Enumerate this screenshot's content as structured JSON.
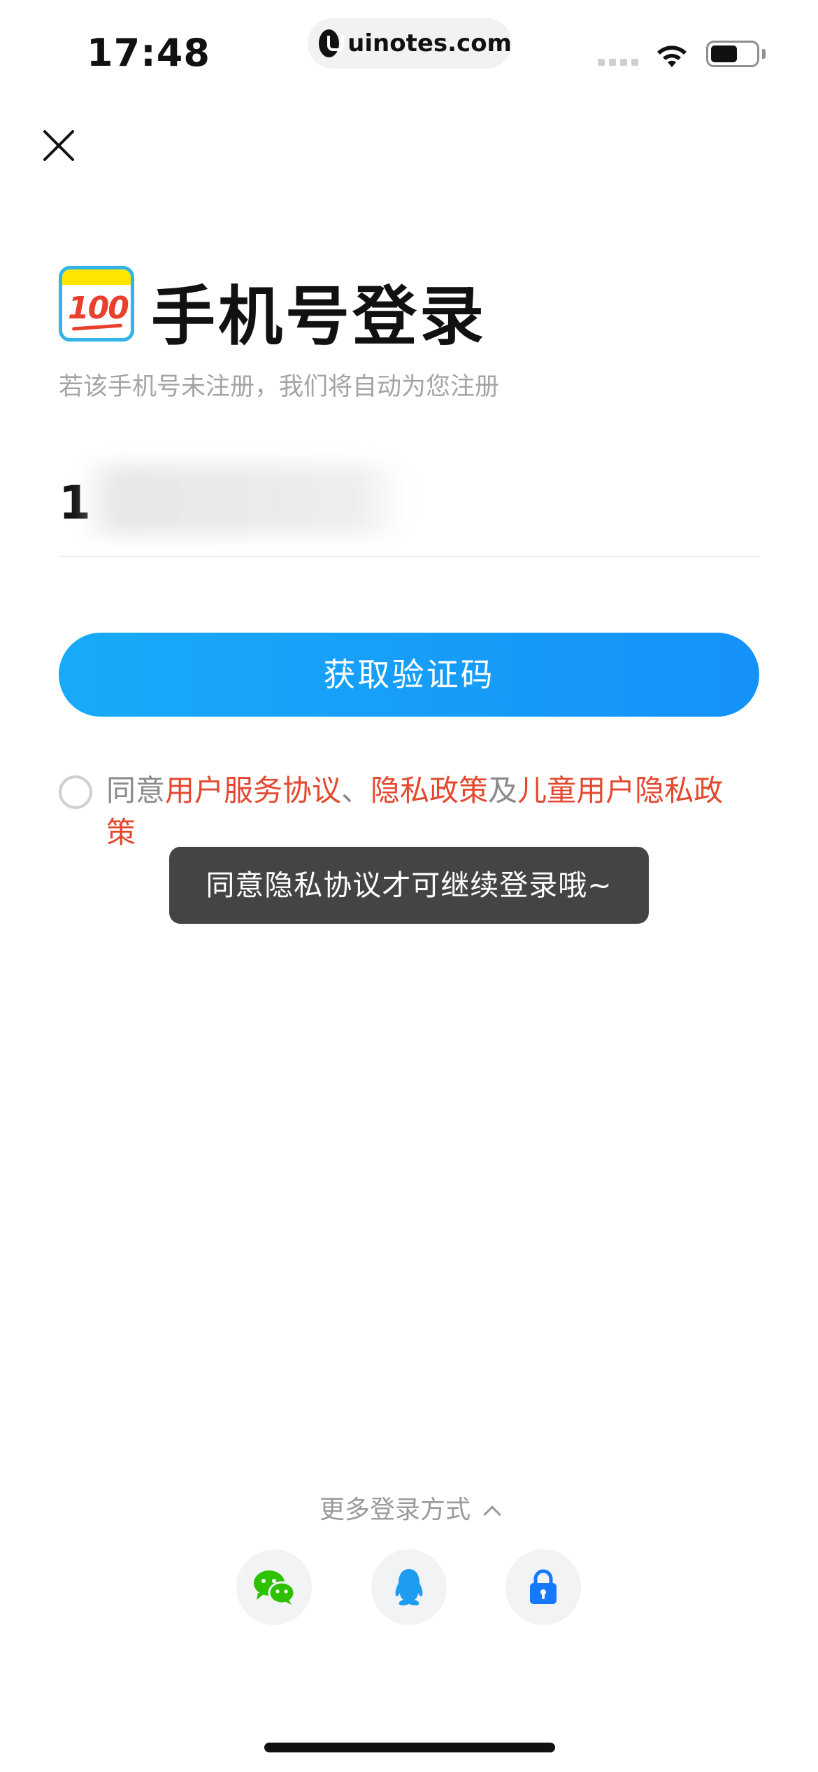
{
  "status_bar": {
    "time": "17:48",
    "url": "uinotes.com",
    "icons": [
      "signal-icon",
      "wifi-icon",
      "battery-icon"
    ]
  },
  "header": {
    "close_icon": "close-icon",
    "app_logo_text": "100",
    "title": "手机号登录",
    "subtitle": "若该手机号未注册，我们将自动为您注册"
  },
  "phone_input": {
    "value": "1"
  },
  "primary_button": {
    "label": "获取验证码"
  },
  "agreement": {
    "prefix": "同意",
    "link_user": "用户服务协议",
    "separator": "、",
    "link_privacy": "隐私政策",
    "conjunction": "及",
    "link_child": "儿童用户隐私政策",
    "checked": false
  },
  "toast": {
    "message": "同意隐私协议才可继续登录哦~"
  },
  "more_login": {
    "label": "更多登录方式",
    "options": [
      {
        "name": "wechat",
        "icon": "wechat-icon",
        "color": "#2dc100"
      },
      {
        "name": "qq",
        "icon": "qq-icon",
        "color": "#1e9cf0"
      },
      {
        "name": "account",
        "icon": "lock-icon",
        "color": "#1677ff"
      }
    ]
  },
  "colors": {
    "accent": "#1aa3fa",
    "link": "#e4482f",
    "toast_bg": "#444444"
  }
}
